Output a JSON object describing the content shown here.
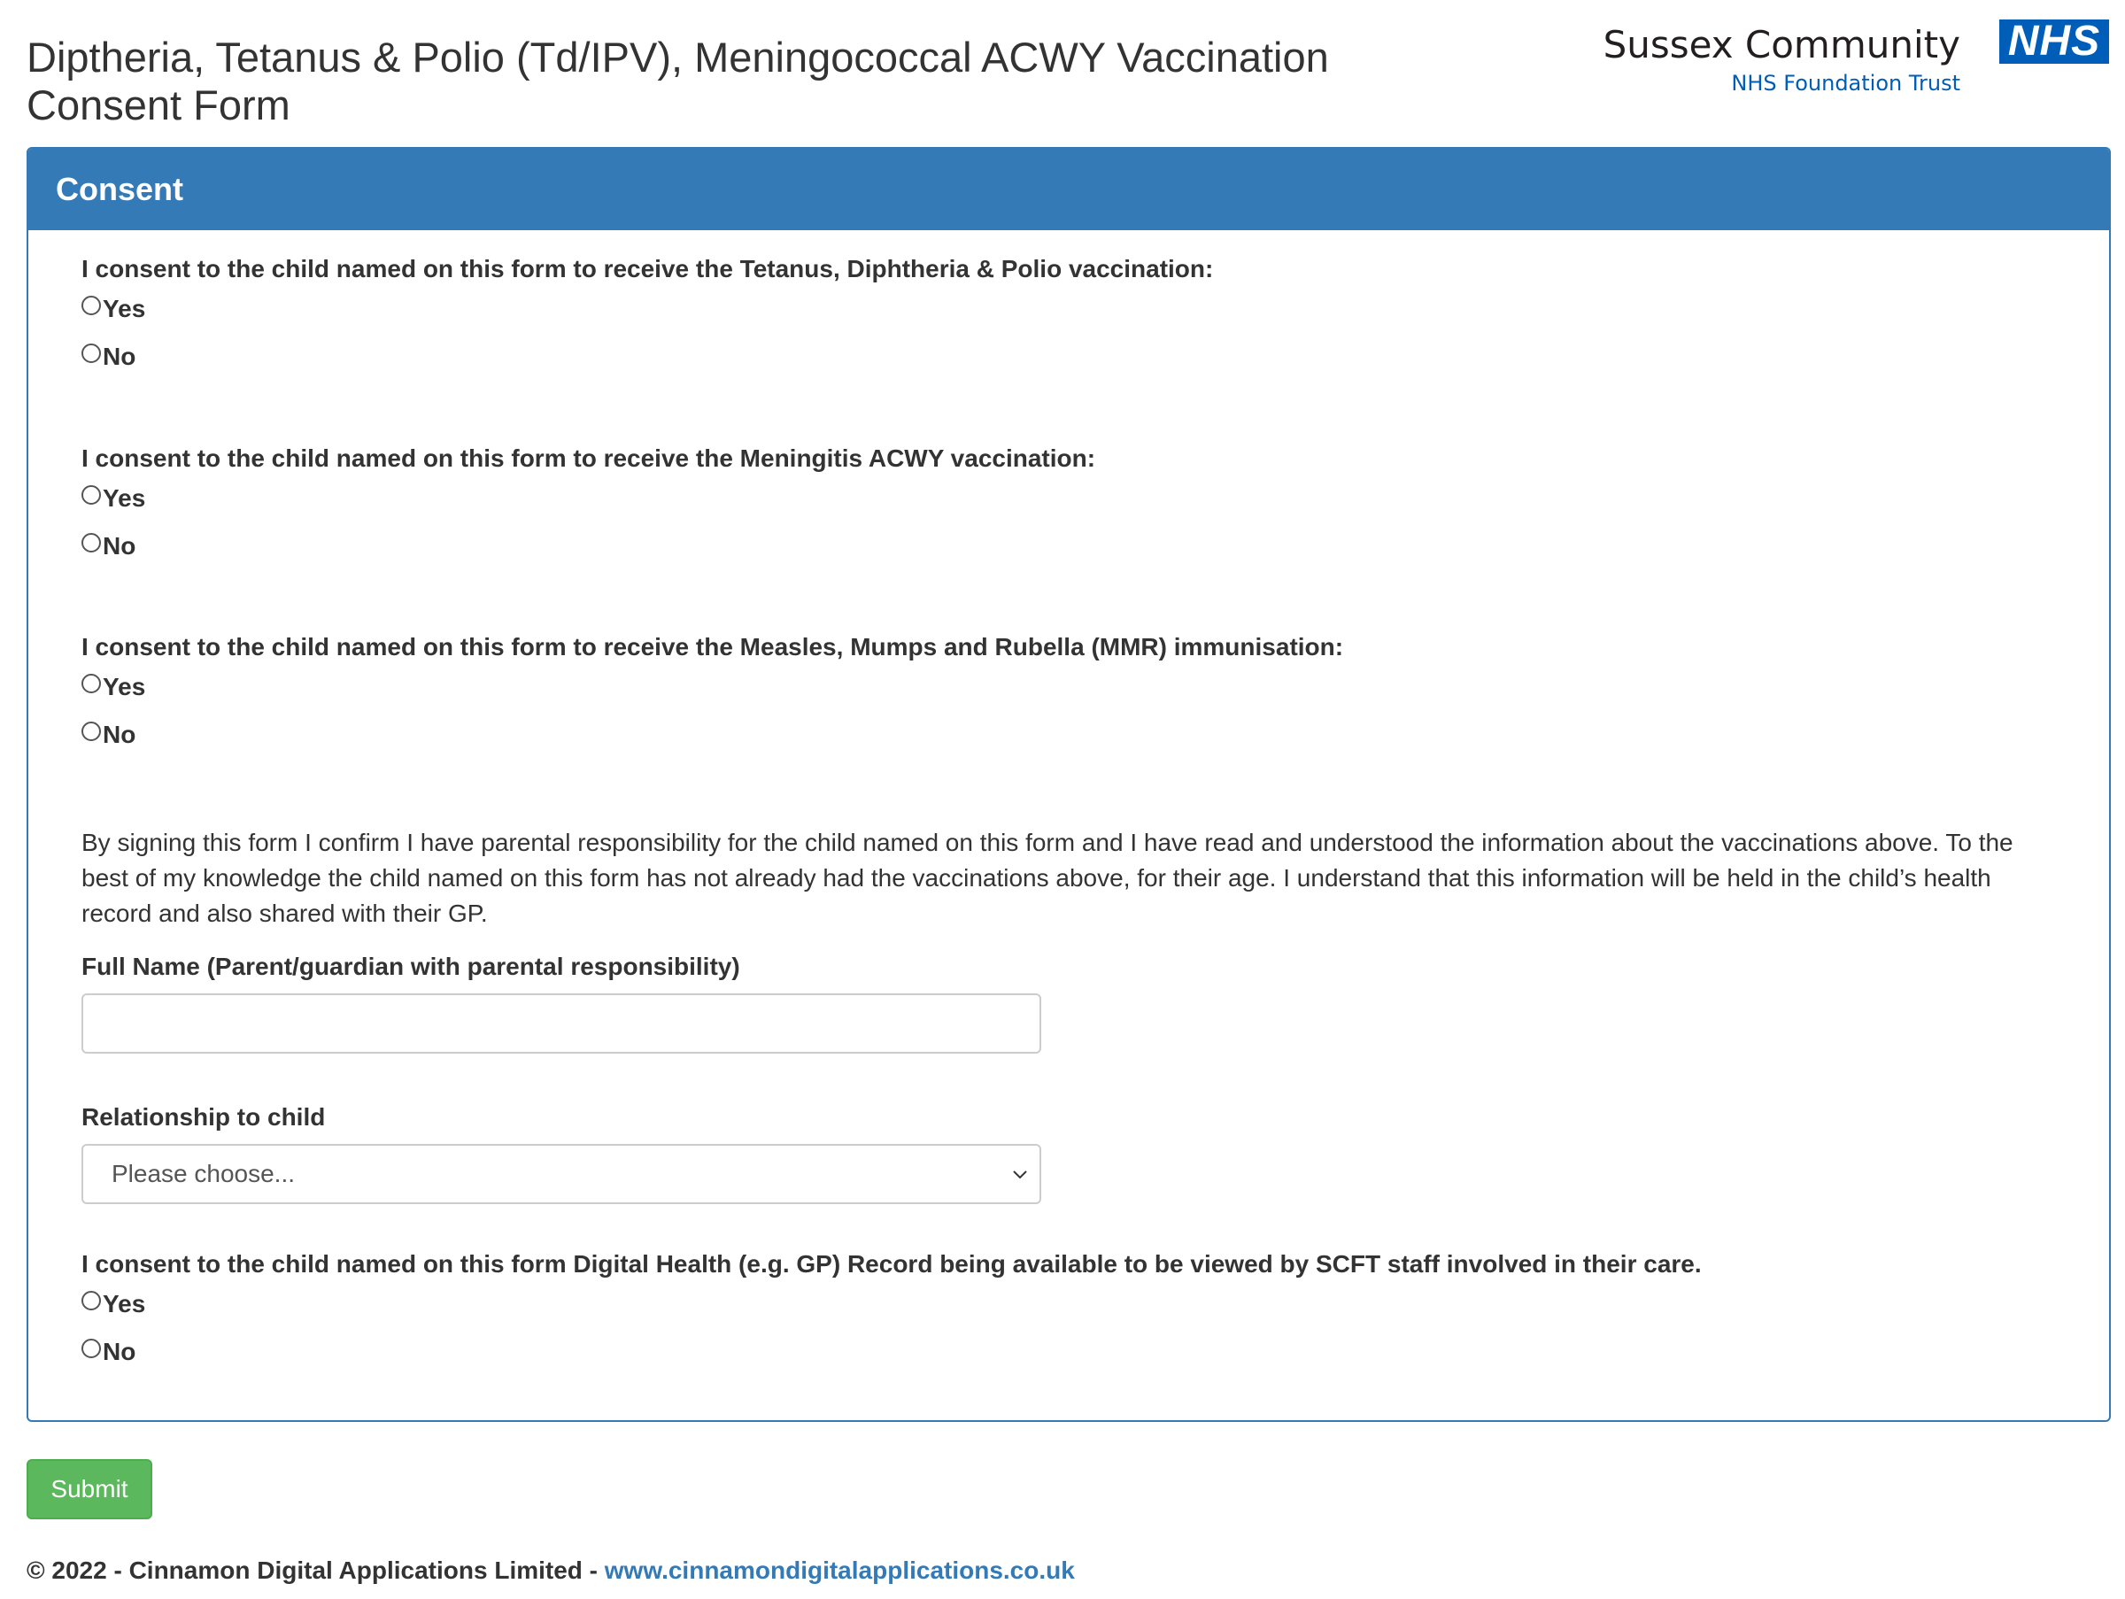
{
  "header": {
    "title_line1": "Diptheria, Tetanus & Polio (Td/IPV), Meningococcal ACWY Vaccination",
    "title_line2": "Consent Form",
    "logo": {
      "name": "Sussex Community",
      "trust": "NHS Foundation Trust",
      "badge": "NHS",
      "badge_color": "#005eb8"
    }
  },
  "panel": {
    "heading": "Consent",
    "accent_color": "#337ab7",
    "questions": [
      {
        "label": "I consent to the child named on this form to receive the Tetanus, Diphtheria & Polio vaccination:",
        "options": [
          "Yes",
          "No"
        ]
      },
      {
        "label": "I consent to the child named on this form to receive the Meningitis ACWY vaccination:",
        "options": [
          "Yes",
          "No"
        ]
      },
      {
        "label": "I consent to the child named on this form to receive the Measles, Mumps and Rubella (MMR) immunisation:",
        "options": [
          "Yes",
          "No"
        ]
      }
    ],
    "declaration": "By signing this form I confirm I have parental responsibility for the child named on this form and I have read and understood the information about the vaccinations above. To the best of my knowledge the child named on this form has not already had the vaccinations above, for their age. I understand that this information will be held in the child’s health record and also shared with their GP.",
    "full_name": {
      "label": "Full Name (Parent/guardian with parental responsibility)",
      "value": ""
    },
    "relationship": {
      "label": "Relationship to child",
      "selected": "Please choose..."
    },
    "digital_record": {
      "label": "I consent to the child named on this form Digital Health (e.g. GP) Record being available to be viewed by SCFT staff involved in their care.",
      "options": [
        "Yes",
        "No"
      ]
    }
  },
  "submit": {
    "label": "Submit",
    "color": "#5cb85c"
  },
  "footer": {
    "copyright": "© 2022 - Cinnamon Digital Applications Limited - ",
    "link": "www.cinnamondigitalapplications.co.uk"
  }
}
